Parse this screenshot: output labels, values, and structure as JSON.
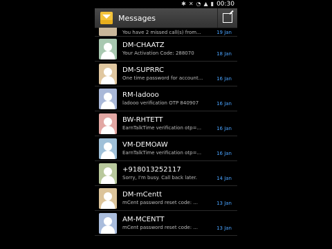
{
  "status": {
    "time": "00:30"
  },
  "app": {
    "title": "Messages"
  },
  "colors": {
    "date": "#4aa3ff",
    "accent": "#f2c23a"
  },
  "messages": [
    {
      "name": "",
      "snippet": "You have 2 missed call(s) from...",
      "date": "19 Jan",
      "avatar_color": "#c9b79a"
    },
    {
      "name": "DM-CHAATZ",
      "snippet": "Your Activation Code: 288070",
      "date": "18 Jan",
      "avatar_color": "#a8c8b0"
    },
    {
      "name": "DM-SUPRRC",
      "snippet": "One time password for account...",
      "date": "16 Jan",
      "avatar_color": "#e0c7a0"
    },
    {
      "name": "RM-ladooo",
      "snippet": "ladooo verification OTP 840907",
      "date": "16 Jan",
      "avatar_color": "#a9b8d8"
    },
    {
      "name": "BW-RHTETT",
      "snippet": "EarnTalkTime verification otp=...",
      "date": "16 Jan",
      "avatar_color": "#e2a7a3"
    },
    {
      "name": "VM-DEMOAW",
      "snippet": "EarnTalkTime verification otp=...",
      "date": "16 Jan",
      "avatar_color": "#9fc0d8"
    },
    {
      "name": "+918013252117",
      "snippet": "Sorry, I'm busy. Call back later.",
      "date": "14 Jan",
      "avatar_color": "#b8c89c"
    },
    {
      "name": "DM-mCentt",
      "snippet": "mCent password reset code: ...",
      "date": "13 Jan",
      "avatar_color": "#dcc49a"
    },
    {
      "name": "AM-MCENTT",
      "snippet": "mCent password reset code: ...",
      "date": "13 Jan",
      "avatar_color": "#a9bcdc"
    }
  ]
}
